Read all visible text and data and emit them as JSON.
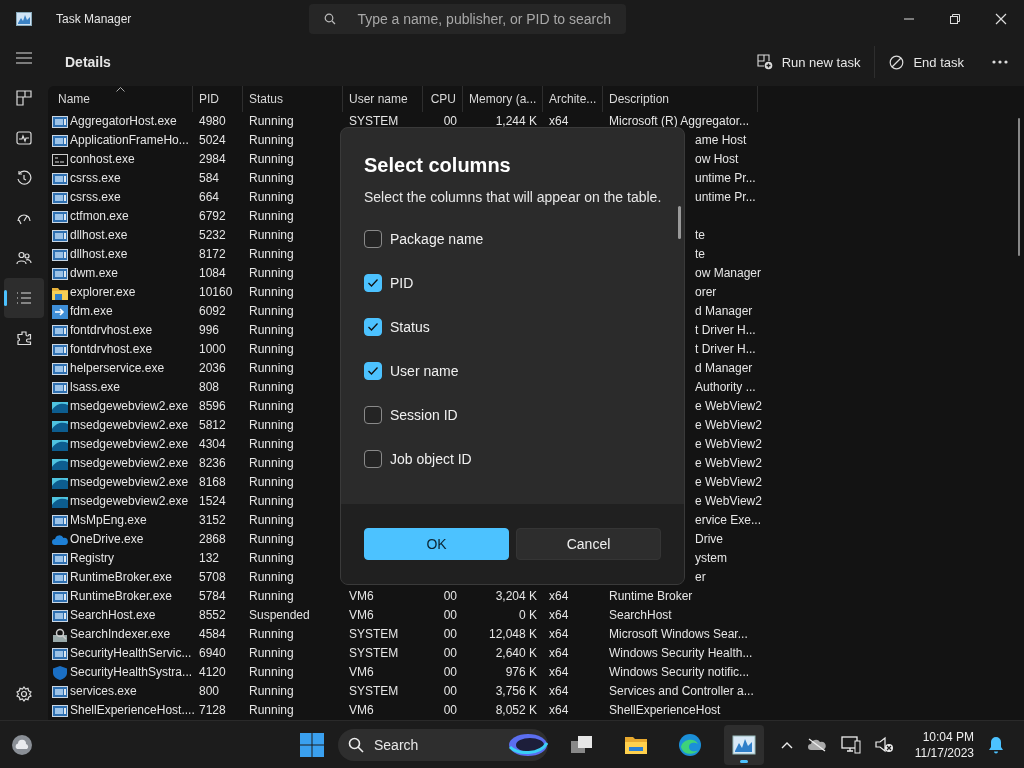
{
  "window": {
    "title": "Task Manager"
  },
  "search": {
    "placeholder": "Type a name, publisher, or PID to search"
  },
  "sidebar": {
    "items": [
      {
        "selected": false
      },
      {
        "selected": false
      },
      {
        "selected": false
      },
      {
        "selected": false
      },
      {
        "selected": false
      },
      {
        "selected": true
      },
      {
        "selected": false
      }
    ]
  },
  "page": {
    "title": "Details"
  },
  "toolbar": {
    "buttons": [
      "Run new task",
      "End task"
    ]
  },
  "table": {
    "columns": [
      {
        "label": "Name",
        "sorted": true
      },
      {
        "label": "PID",
        "sorted": false
      },
      {
        "label": "Status",
        "sorted": false
      },
      {
        "label": "User name",
        "sorted": false
      },
      {
        "label": "CPU",
        "sorted": false
      },
      {
        "label": "Memory (a...",
        "sorted": false
      },
      {
        "label": "Archite...",
        "sorted": false
      },
      {
        "label": "Description",
        "sorted": false
      }
    ],
    "rows": [
      {
        "kind": "app",
        "name": "AggregatorHost.exe",
        "pid": "4980",
        "status": "Running",
        "user": "SYSTEM",
        "cpu": "00",
        "memory": "1,244 K",
        "arch": "x64",
        "description": "Microsoft (R) Aggregator..."
      },
      {
        "kind": "app",
        "name": "ApplicationFrameHo...",
        "pid": "5024",
        "status": "Running",
        "description": "ame Host"
      },
      {
        "kind": "console",
        "name": "conhost.exe",
        "pid": "2984",
        "status": "Running",
        "description": "ow Host"
      },
      {
        "kind": "app",
        "name": "csrss.exe",
        "pid": "584",
        "status": "Running",
        "description": "untime Pr..."
      },
      {
        "kind": "app",
        "name": "csrss.exe",
        "pid": "664",
        "status": "Running",
        "description": "untime Pr..."
      },
      {
        "kind": "app",
        "name": "ctfmon.exe",
        "pid": "6792",
        "status": "Running"
      },
      {
        "kind": "app",
        "name": "dllhost.exe",
        "pid": "5232",
        "status": "Running",
        "description": "te"
      },
      {
        "kind": "app",
        "name": "dllhost.exe",
        "pid": "8172",
        "status": "Running",
        "description": "te"
      },
      {
        "kind": "app",
        "name": "dwm.exe",
        "pid": "1084",
        "status": "Running",
        "description": "ow Manager"
      },
      {
        "kind": "folder",
        "name": "explorer.exe",
        "pid": "10160",
        "status": "Running",
        "description": "orer"
      },
      {
        "kind": "download",
        "name": "fdm.exe",
        "pid": "6092",
        "status": "Running",
        "description": "d Manager"
      },
      {
        "kind": "app",
        "name": "fontdrvhost.exe",
        "pid": "996",
        "status": "Running",
        "description": "t Driver H..."
      },
      {
        "kind": "app",
        "name": "fontdrvhost.exe",
        "pid": "1000",
        "status": "Running",
        "description": "t Driver H..."
      },
      {
        "kind": "app",
        "name": "helperservice.exe",
        "pid": "2036",
        "status": "Running",
        "description": "d Manager"
      },
      {
        "kind": "app",
        "name": "lsass.exe",
        "pid": "808",
        "status": "Running",
        "description": "Authority ..."
      },
      {
        "kind": "webview",
        "name": "msedgewebview2.exe",
        "pid": "8596",
        "status": "Running",
        "description": "e WebView2"
      },
      {
        "kind": "webview",
        "name": "msedgewebview2.exe",
        "pid": "5812",
        "status": "Running",
        "description": "e WebView2"
      },
      {
        "kind": "webview",
        "name": "msedgewebview2.exe",
        "pid": "4304",
        "status": "Running",
        "description": "e WebView2"
      },
      {
        "kind": "webview",
        "name": "msedgewebview2.exe",
        "pid": "8236",
        "status": "Running",
        "description": "e WebView2"
      },
      {
        "kind": "webview",
        "name": "msedgewebview2.exe",
        "pid": "8168",
        "status": "Running",
        "description": "e WebView2"
      },
      {
        "kind": "webview",
        "name": "msedgewebview2.exe",
        "pid": "1524",
        "status": "Running",
        "description": "e WebView2"
      },
      {
        "kind": "app",
        "name": "MsMpEng.exe",
        "pid": "3152",
        "status": "Running",
        "description": "ervice Exe..."
      },
      {
        "kind": "cloud",
        "name": "OneDrive.exe",
        "pid": "2868",
        "status": "Running",
        "description": "Drive"
      },
      {
        "kind": "app",
        "name": "Registry",
        "pid": "132",
        "status": "Running",
        "description": "ystem"
      },
      {
        "kind": "app",
        "name": "RuntimeBroker.exe",
        "pid": "5708",
        "status": "Running",
        "description": "er"
      },
      {
        "kind": "app",
        "name": "RuntimeBroker.exe",
        "pid": "5784",
        "status": "Running",
        "user": "VM6",
        "cpu": "00",
        "memory": "3,204 K",
        "arch": "x64",
        "description": "Runtime Broker"
      },
      {
        "kind": "app",
        "name": "SearchHost.exe",
        "pid": "8552",
        "status": "Suspended",
        "user": "VM6",
        "cpu": "00",
        "memory": "0 K",
        "arch": "x64",
        "description": "SearchHost"
      },
      {
        "kind": "indexer",
        "name": "SearchIndexer.exe",
        "pid": "4584",
        "status": "Running",
        "user": "SYSTEM",
        "cpu": "00",
        "memory": "12,048 K",
        "arch": "x64",
        "description": "Microsoft Windows Sear..."
      },
      {
        "kind": "app",
        "name": "SecurityHealthServic...",
        "pid": "6940",
        "status": "Running",
        "user": "SYSTEM",
        "cpu": "00",
        "memory": "2,640 K",
        "arch": "x64",
        "description": "Windows Security Health..."
      },
      {
        "kind": "shield",
        "name": "SecurityHealthSystra...",
        "pid": "4120",
        "status": "Running",
        "user": "VM6",
        "cpu": "00",
        "memory": "976 K",
        "arch": "x64",
        "description": "Windows Security notific..."
      },
      {
        "kind": "app",
        "name": "services.exe",
        "pid": "800",
        "status": "Running",
        "user": "SYSTEM",
        "cpu": "00",
        "memory": "3,756 K",
        "arch": "x64",
        "description": "Services and Controller a..."
      },
      {
        "kind": "app",
        "name": "ShellExperienceHost....",
        "pid": "7128",
        "status": "Running",
        "user": "VM6",
        "cpu": "00",
        "memory": "8,052 K",
        "arch": "x64",
        "description": "ShellExperienceHost"
      }
    ]
  },
  "dialog": {
    "title": "Select columns",
    "subtitle": "Select the columns that will appear on the table.",
    "options": [
      {
        "label": "Package name",
        "checked": false
      },
      {
        "label": "PID",
        "checked": true
      },
      {
        "label": "Status",
        "checked": true
      },
      {
        "label": "User name",
        "checked": true
      },
      {
        "label": "Session ID",
        "checked": false
      },
      {
        "label": "Job object ID",
        "checked": false
      }
    ],
    "buttons": [
      {
        "label": "OK",
        "kind": "primary"
      },
      {
        "label": "Cancel",
        "kind": "secondary"
      }
    ]
  },
  "taskbar": {
    "search_label": "Search",
    "apps": [
      {
        "selected": false
      },
      {
        "selected": false
      },
      {
        "selected": false
      },
      {
        "selected": true
      }
    ],
    "clock": {
      "time": "10:04 PM",
      "date": "11/17/2023"
    }
  }
}
